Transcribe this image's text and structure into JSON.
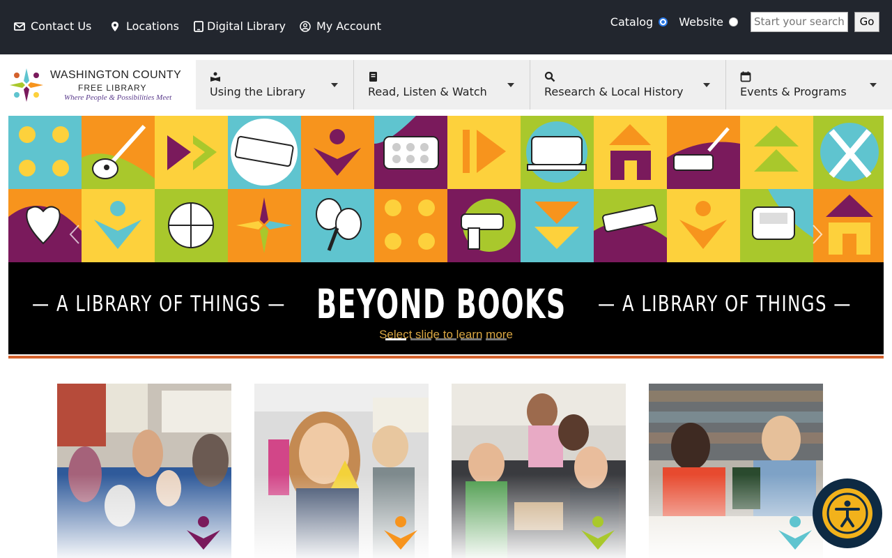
{
  "top_links": {
    "contact": "Contact Us",
    "locations": "Locations",
    "digital": "Digital Library",
    "account": "My Account"
  },
  "search": {
    "catalog_label": "Catalog",
    "website_label": "Website",
    "placeholder": "Start your search",
    "go_label": "Go",
    "selected": "Catalog"
  },
  "logo": {
    "title": "WASHINGTON COUNTY",
    "subtitle": "FREE LIBRARY",
    "tagline": "Where People & Possibilities Meet"
  },
  "nav": {
    "items": [
      {
        "label": "Using the Library",
        "icon": "reading-icon"
      },
      {
        "label": "Read, Listen & Watch",
        "icon": "book-icon"
      },
      {
        "label": "Research & Local History",
        "icon": "search-icon"
      },
      {
        "label": "Events & Programs",
        "icon": "calendar-icon"
      }
    ]
  },
  "carousel": {
    "side_text": "— A LIBRARY OF THINGS —",
    "main_text": "BEYOND BOOKS",
    "caption": "Select slide to learn more",
    "slide_count": 5,
    "active_slide": 1
  },
  "colors": {
    "topbar": "#22262e",
    "accent_orange": "#d3612c",
    "tile_teal": "#5fc4cf",
    "tile_yellow": "#fdd13c",
    "tile_orange": "#f7941d",
    "tile_purple": "#7a1a5c",
    "tile_green": "#a9c82c",
    "a11y_gold": "#f2b21b"
  }
}
